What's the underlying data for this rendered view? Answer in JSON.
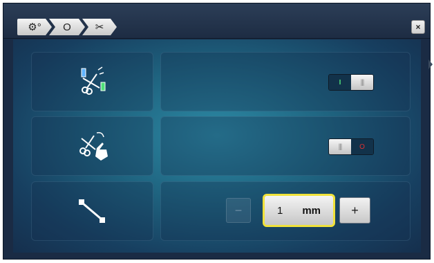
{
  "titlebar": {
    "breadcrumbs": [
      {
        "label": "⚙°",
        "icon": "settings-gear-icon"
      },
      {
        "label": "O",
        "icon": "bobbin-icon"
      },
      {
        "label": "✂",
        "icon": "scissors-icon"
      }
    ],
    "close_label": "×"
  },
  "rows": [
    {
      "icon": "thread-cutter-icon",
      "control": "toggle",
      "state": "on",
      "on_label": "I",
      "knob_label": "|||"
    },
    {
      "icon": "manual-cut-icon",
      "control": "toggle",
      "state": "off",
      "off_label": "O",
      "knob_label": "|||"
    },
    {
      "icon": "stitch-length-icon",
      "control": "stepper",
      "minus_label": "−",
      "plus_label": "+",
      "value": "1",
      "unit": "mm"
    }
  ],
  "colors": {
    "background": "#1f6480",
    "highlight": "#f0e23a",
    "on_indicator": "#4fe07a",
    "off_indicator": "#e03030"
  }
}
